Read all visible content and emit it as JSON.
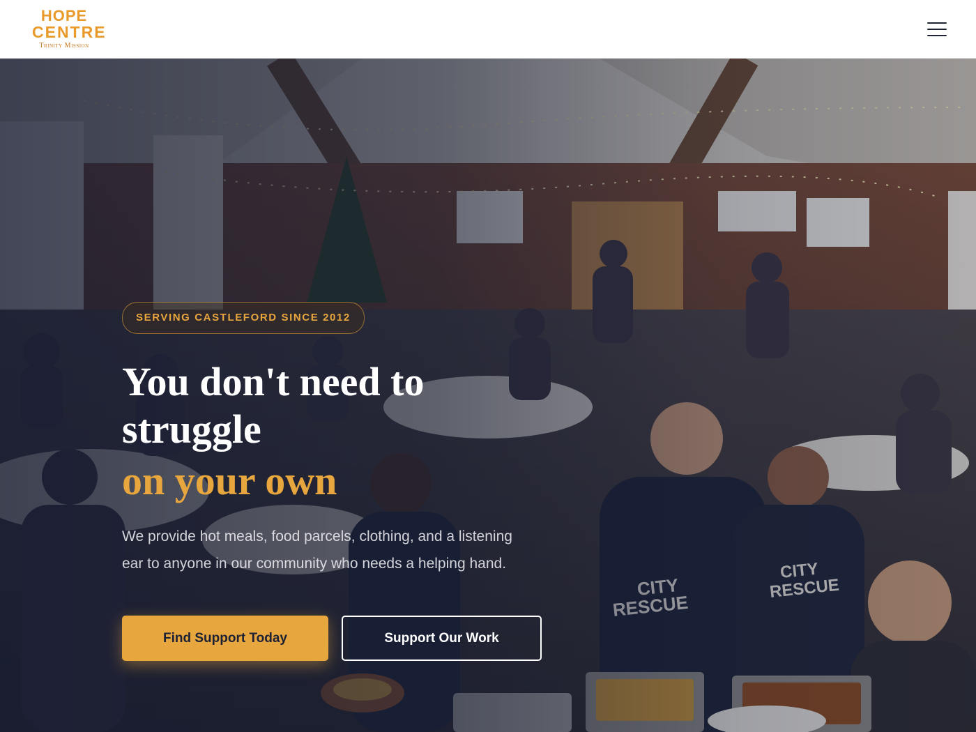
{
  "header": {
    "logo_line1": "HOPE",
    "logo_line2": "CENTRE",
    "logo_sub": "Trinity Mission",
    "menu_icon": "hamburger-menu-icon"
  },
  "hero": {
    "badge": "SERVING CASTLEFORD SINCE 2012",
    "headline": "You don't need to struggle",
    "headline_accent": "on your own",
    "lead": "We provide hot meals, food parcels, clothing, and a listening ear to anyone in our community who needs a helping hand.",
    "primary_cta": "Find Support Today",
    "secondary_cta": "Support Our Work",
    "colors": {
      "accent": "#e8a63e",
      "overlay": "#141a30",
      "text": "#ffffff"
    }
  }
}
